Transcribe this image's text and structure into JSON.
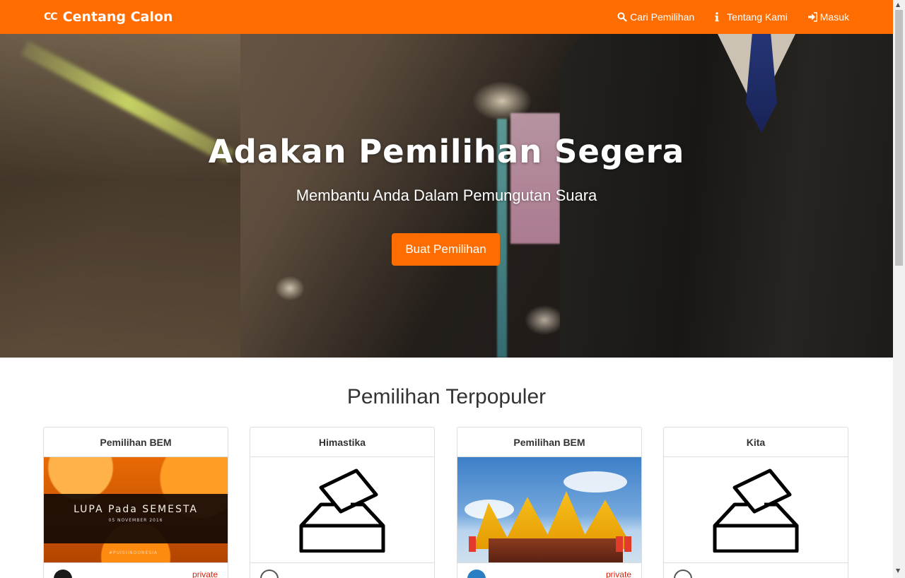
{
  "navbar": {
    "logo_mark": "CC",
    "brand": "Centang Calon",
    "links": [
      {
        "label": "Cari Pemilihan",
        "icon": "search-icon"
      },
      {
        "label": "Tentang Kami",
        "icon": "info-icon"
      },
      {
        "label": "Masuk",
        "icon": "sign-in-icon"
      }
    ]
  },
  "hero": {
    "title": "Adakan Pemilihan Segera",
    "subtitle": "Membantu Anda Dalam Pemungutan Suara",
    "cta": "Buat Pemilihan"
  },
  "section": {
    "title": "Pemilihan Terpopuler"
  },
  "cards": [
    {
      "title": "Pemilihan BEM",
      "image_text": "LUPA Pada SEMESTA",
      "image_subtext": "05 NOVEMBER 2016",
      "image_tag": "#PUISIINDONESIA",
      "owner": "",
      "privacy": "private"
    },
    {
      "title": "Himastika",
      "owner": "",
      "privacy": ""
    },
    {
      "title": "Pemilihan BEM",
      "owner": "",
      "privacy": "private"
    },
    {
      "title": "Kita",
      "owner": "",
      "privacy": ""
    }
  ],
  "colors": {
    "brand": "#ff6d00",
    "private": "#d9230f"
  }
}
